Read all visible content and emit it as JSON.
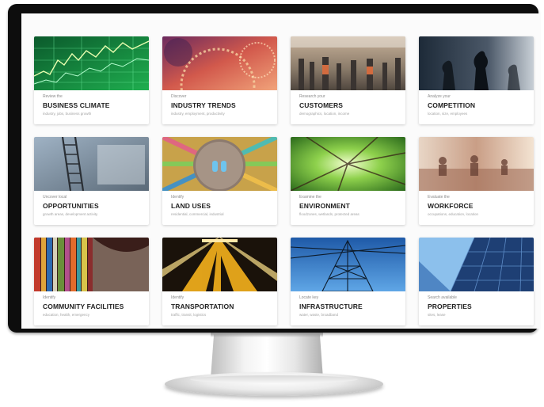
{
  "cards": [
    {
      "kicker": "Review the",
      "title": "BUSINESS CLIMATE",
      "sub": "industry, jobs, business growth"
    },
    {
      "kicker": "Discover",
      "title": "INDUSTRY TRENDS",
      "sub": "industry, employment, productivity"
    },
    {
      "kicker": "Research your",
      "title": "CUSTOMERS",
      "sub": "demographics, location, income"
    },
    {
      "kicker": "Analyze your",
      "title": "COMPETITION",
      "sub": "location, size, employees"
    },
    {
      "kicker": "Uncover local",
      "title": "OPPORTUNITIES",
      "sub": "growth areas, development activity"
    },
    {
      "kicker": "Identify",
      "title": "LAND USES",
      "sub": "residential, commercial, industrial"
    },
    {
      "kicker": "Examine the",
      "title": "ENVIRONMENT",
      "sub": "floodzones, wetlands, protected areas"
    },
    {
      "kicker": "Evaluate the",
      "title": "WORKFORCE",
      "sub": "occupations, education, location"
    },
    {
      "kicker": "Identify",
      "title": "COMMUNITY FACILITIES",
      "sub": "education, health, emergency"
    },
    {
      "kicker": "Identify",
      "title": "TRANSPORTATION",
      "sub": "traffic, transit, logistics"
    },
    {
      "kicker": "Locate key",
      "title": "INFRASTRUCTURE",
      "sub": "water, waste, broadband"
    },
    {
      "kicker": "Search available",
      "title": "PROPERTIES",
      "sub": "sites, lease"
    }
  ],
  "colors": {
    "screen_bg": "#fbfbfb",
    "bezel": "#0d0d0d",
    "title_text": "#222222"
  }
}
